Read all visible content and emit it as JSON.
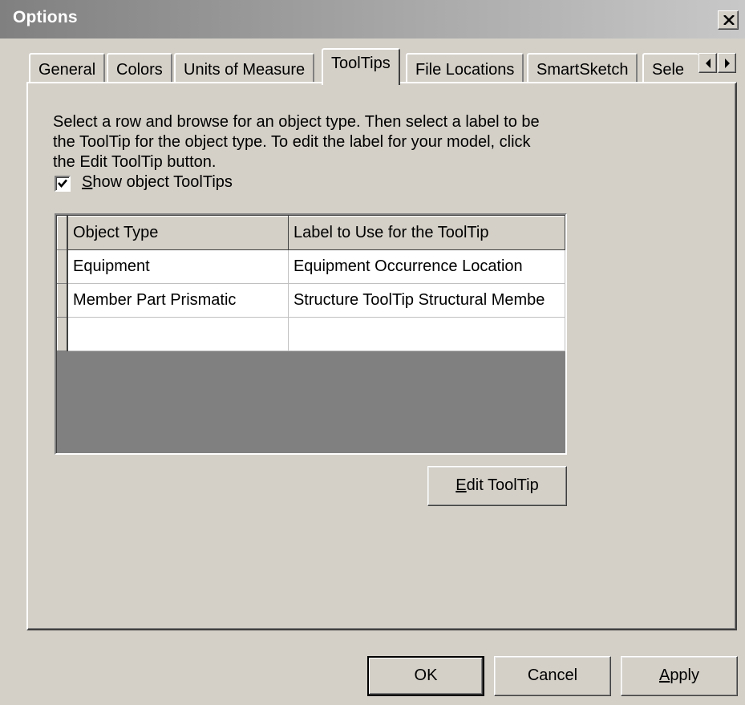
{
  "window": {
    "title": "Options",
    "close_icon": "close-icon"
  },
  "tabs": [
    {
      "label": "General",
      "active": false
    },
    {
      "label": "Colors",
      "active": false
    },
    {
      "label": "Units of Measure",
      "active": false
    },
    {
      "label": "ToolTips",
      "active": true
    },
    {
      "label": "File Locations",
      "active": false
    },
    {
      "label": "SmartSketch",
      "active": false
    },
    {
      "label": "Sele",
      "active": false
    }
  ],
  "tab_scroll": {
    "left_icon": "arrow-left-icon",
    "right_icon": "arrow-right-icon"
  },
  "tooltips_page": {
    "instructions": [
      "Select a row and browse for an object type. Then select a label to be",
      "the ToolTip for the object type. To edit the label for your model, click",
      "the Edit ToolTip button."
    ],
    "show_tooltips": {
      "mnemonic": "S",
      "label_rest": "how object ToolTips",
      "checked": true
    },
    "grid": {
      "columns": [
        "Object Type",
        "Label to Use for the ToolTip"
      ],
      "rows": [
        [
          "Equipment",
          "Equipment Occurrence Location"
        ],
        [
          "Member Part Prismatic",
          "Structure ToolTip Structural Membe"
        ],
        [
          "",
          ""
        ]
      ]
    },
    "edit_button": {
      "mnemonic": "E",
      "label_rest": "dit ToolTip"
    }
  },
  "footer": {
    "ok": "OK",
    "cancel": "Cancel",
    "apply_mnemonic": "A",
    "apply_rest": "pply"
  }
}
